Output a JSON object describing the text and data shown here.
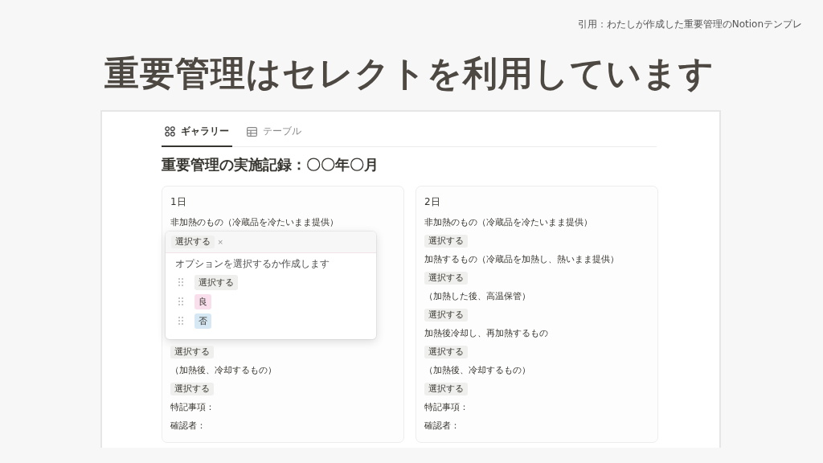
{
  "citation": "引用：わたしが作成した重要管理のNotionテンプレ",
  "heading": "重要管理はセレクトを利用しています",
  "screenshot": {
    "tabs": [
      {
        "label": "ギャラリー",
        "selected": true
      },
      {
        "label": "テーブル",
        "selected": false
      }
    ],
    "title": "重要管理の実施記録：〇〇年〇月",
    "cards": [
      {
        "title": "1日",
        "items": [
          {
            "kind": "label",
            "text": "非加熱のもの（冷蔵品を冷たいまま提供）"
          },
          {
            "kind": "popup",
            "value": "選択する",
            "remove": "×",
            "hint": "オプションを選択するか作成します",
            "options": [
              {
                "text": "選択する",
                "color": "#efefed"
              },
              {
                "text": "良",
                "color": "#f9dfec"
              },
              {
                "text": "否",
                "color": "#d6e8f4"
              }
            ]
          },
          {
            "kind": "tag",
            "text": "選択する"
          },
          {
            "kind": "label",
            "text": "（加熱後、冷却するもの）"
          },
          {
            "kind": "tag",
            "text": "選択する"
          },
          {
            "kind": "label",
            "text": "特記事項："
          },
          {
            "kind": "label",
            "text": "確認者："
          }
        ]
      },
      {
        "title": "2日",
        "items": [
          {
            "kind": "label",
            "text": "非加熱のもの（冷蔵品を冷たいまま提供）"
          },
          {
            "kind": "tag",
            "text": "選択する"
          },
          {
            "kind": "label",
            "text": "加熱するもの（冷蔵品を加熱し、熱いまま提供）"
          },
          {
            "kind": "tag",
            "text": "選択する"
          },
          {
            "kind": "label",
            "text": "（加熱した後、高温保管）"
          },
          {
            "kind": "tag",
            "text": "選択する"
          },
          {
            "kind": "label",
            "text": "加熱後冷却し、再加熱するもの"
          },
          {
            "kind": "tag",
            "text": "選択する"
          },
          {
            "kind": "label",
            "text": "（加熱後、冷却するもの）"
          },
          {
            "kind": "tag",
            "text": "選択する"
          },
          {
            "kind": "label",
            "text": "特記事項："
          },
          {
            "kind": "label",
            "text": "確認者："
          }
        ]
      }
    ]
  }
}
